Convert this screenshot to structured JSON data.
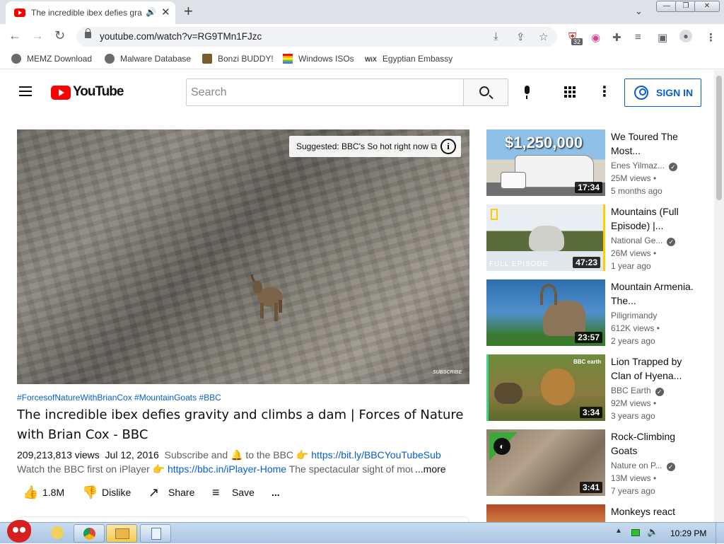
{
  "browser": {
    "tab_title": "The incredible ibex defies gra",
    "url": "youtube.com/watch?v=RG9TMn1FJzc",
    "extension_badge": "32",
    "bookmarks": [
      "MEMZ Download",
      "Malware Database",
      "Bonzi BUDDY!",
      "Windows ISOs",
      "Egyptian Embassy"
    ]
  },
  "youtube": {
    "logo_text": "YouTube",
    "search_placeholder": "Search",
    "sign_in_label": "SIGN IN",
    "suggestion": "Suggested: BBC's So hot right now ⧉",
    "watermark": "SUBSCRIBE",
    "hashtags": "#ForcesofNatureWithBrianCox #MountainGoats #BBC",
    "title": "The incredible ibex defies gravity and climbs a dam | Forces of Nature with Brian Cox - BBC",
    "views": "209,213,813 views",
    "date": "Jul 12, 2016",
    "desc_line1_prefix": "Subscribe and 🔔 to the BBC 👉",
    "desc_line1_link": "https://bit.ly/BBCYouTubeSub",
    "desc_line2_prefix": "Watch the BBC first on iPlayer 👉",
    "desc_line2_link": "https://bbc.in/iPlayer-Home",
    "desc_line2_suffix": "The spectacular sight of mountain",
    "more_label": "...more",
    "actions": {
      "likes": "1.8M",
      "dislike": "Dislike",
      "share": "Share",
      "save": "Save",
      "more": "..."
    },
    "recommendations": [
      {
        "title": "We Toured The Most...",
        "channel": "Enes Yilmaz...",
        "views": "25M views •",
        "age": "5 months ago",
        "duration": "17:34",
        "overlay": "$1,250,000"
      },
      {
        "title": "Mountains (Full Episode) |...",
        "channel": "National Ge...",
        "views": "26M views •",
        "age": "1 year ago",
        "duration": "47:23",
        "overlay": "FULL EPISODE"
      },
      {
        "title": "Mountain Armenia. The...",
        "channel": "Piligrimandy",
        "views": "612K views •",
        "age": "2 years ago",
        "duration": "23:57",
        "overlay": ""
      },
      {
        "title": "Lion Trapped by Clan of Hyena...",
        "channel": "BBC Earth",
        "views": "92M views •",
        "age": "3 years ago",
        "duration": "3:34",
        "overlay": "BBC earth"
      },
      {
        "title": "Rock-Climbing Goats",
        "channel": "Nature on P...",
        "views": "13M views •",
        "age": "7 years ago",
        "duration": "3:41",
        "overlay": ""
      },
      {
        "title": "Monkeys react",
        "channel": "",
        "views": "",
        "age": "",
        "duration": "",
        "overlay": ""
      }
    ]
  },
  "taskbar": {
    "clock": "10:29 PM"
  },
  "colors": {
    "youtube_red": "#ff0000",
    "link_blue": "#065fd4",
    "tab_strip": "#dee1e6"
  }
}
